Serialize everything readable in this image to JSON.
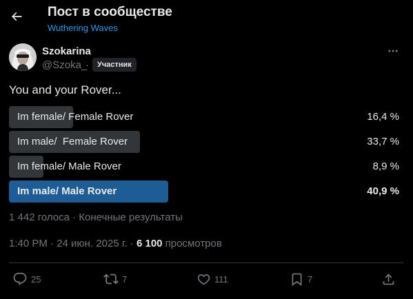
{
  "header": {
    "title": "Пост в сообществе",
    "community": "Wuthering Waves"
  },
  "author": {
    "name": "Szokarina",
    "handle": "@Szoka_",
    "separator": "·",
    "badge": "Участник"
  },
  "post": {
    "text": "You and your Rover..."
  },
  "poll": {
    "options": [
      {
        "label": "Im female/ Female Rover",
        "percent_text": "16,4 %",
        "percent": 16.4
      },
      {
        "label": "Im male/  Female Rover",
        "percent_text": "33,7 %",
        "percent": 33.7
      },
      {
        "label": "Im female/ Male Rover",
        "percent_text": "8,9 %",
        "percent": 8.9
      },
      {
        "label": "Im male/ Male Rover",
        "percent_text": "40,9 %",
        "percent": 40.9
      }
    ],
    "summary": "1 442 голоса · Конечные результаты"
  },
  "meta": {
    "time_date": "1:40 PM · 24 июн. 2025 г. · ",
    "views": "6 100",
    "views_label": " просмотров"
  },
  "actions": {
    "replies": "25",
    "reposts": "7",
    "likes": "111",
    "bookmarks": "7"
  },
  "colors": {
    "background": "#000000",
    "text": "#e7e9ea",
    "muted": "#71767b",
    "accent": "#1d9bf0",
    "poll_bar": "#333639",
    "poll_bar_winner": "#1d5c94"
  }
}
